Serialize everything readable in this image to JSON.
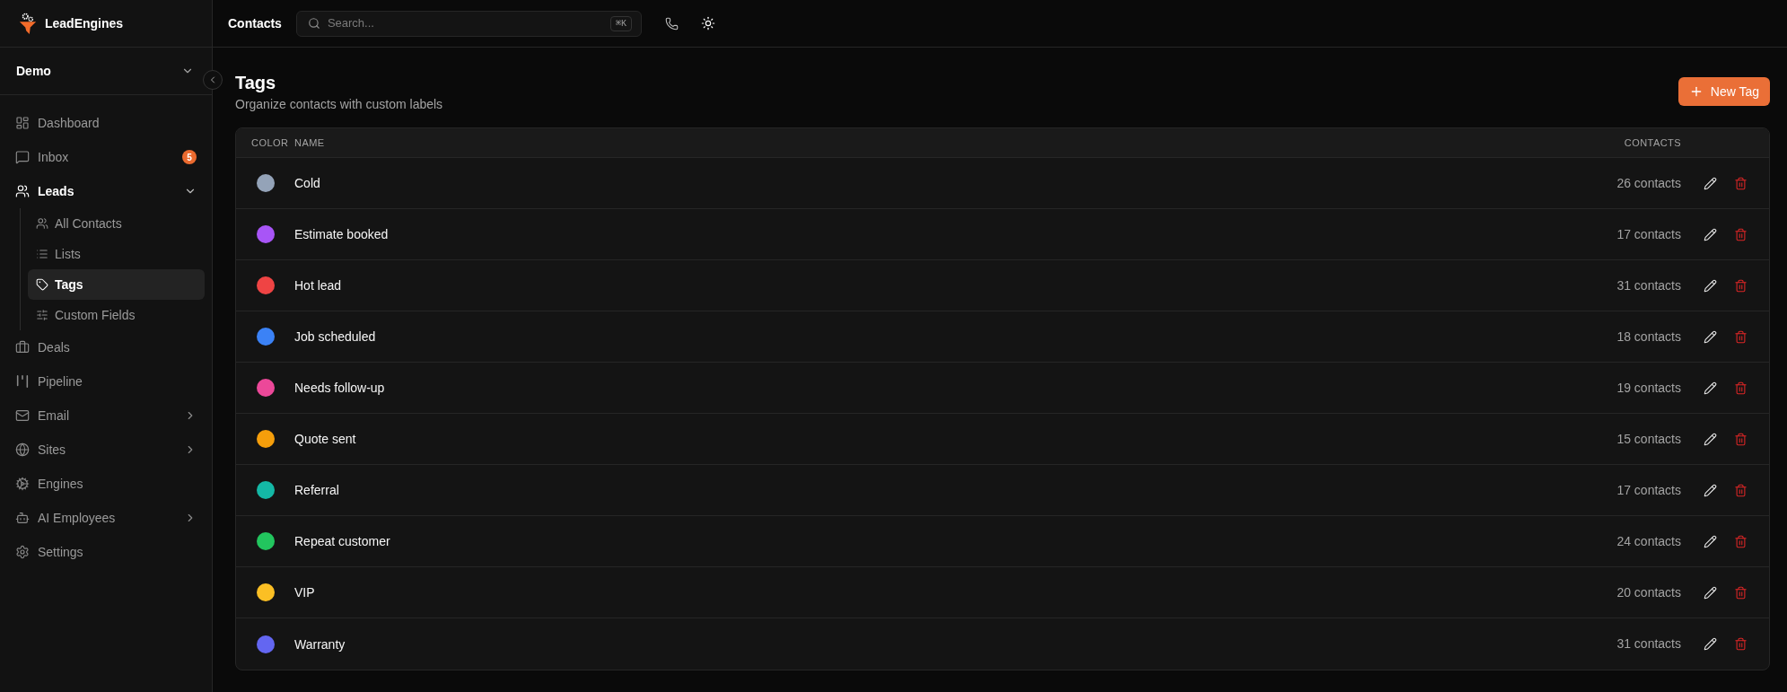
{
  "app": {
    "name": "LeadEngines"
  },
  "workspace": {
    "name": "Demo"
  },
  "sidebar": {
    "items": [
      {
        "label": "Dashboard",
        "selected": false
      },
      {
        "label": "Inbox",
        "selected": false,
        "badge": "5"
      },
      {
        "label": "Leads",
        "selected": false,
        "expanded": true,
        "children": [
          {
            "label": "All Contacts",
            "selected": false
          },
          {
            "label": "Lists",
            "selected": false
          },
          {
            "label": "Tags",
            "selected": true
          },
          {
            "label": "Custom Fields",
            "selected": false
          }
        ]
      },
      {
        "label": "Deals",
        "selected": false
      },
      {
        "label": "Pipeline",
        "selected": false
      },
      {
        "label": "Email",
        "selected": false,
        "expanded": false
      },
      {
        "label": "Sites",
        "selected": false,
        "expanded": false
      },
      {
        "label": "Engines",
        "selected": false
      },
      {
        "label": "AI Employees",
        "selected": false,
        "expanded": false
      },
      {
        "label": "Settings",
        "selected": false
      }
    ]
  },
  "topbar": {
    "title": "Contacts",
    "search": {
      "placeholder": "Search...",
      "shortcut": "⌘K"
    }
  },
  "page": {
    "title": "Tags",
    "subtitle": "Organize contacts with custom labels",
    "primary_button": "New Tag"
  },
  "table": {
    "columns": [
      "COLOR",
      "NAME",
      "CONTACTS"
    ],
    "rows": [
      {
        "name": "Cold",
        "color": "#94a3b8",
        "contacts": "26 contacts"
      },
      {
        "name": "Estimate booked",
        "color": "#a855f7",
        "contacts": "17 contacts"
      },
      {
        "name": "Hot lead",
        "color": "#ef4444",
        "contacts": "31 contacts"
      },
      {
        "name": "Job scheduled",
        "color": "#3b82f6",
        "contacts": "18 contacts"
      },
      {
        "name": "Needs follow-up",
        "color": "#ec4899",
        "contacts": "19 contacts"
      },
      {
        "name": "Quote sent",
        "color": "#f59e0b",
        "contacts": "15 contacts"
      },
      {
        "name": "Referral",
        "color": "#14b8a6",
        "contacts": "17 contacts"
      },
      {
        "name": "Repeat customer",
        "color": "#22c55e",
        "contacts": "24 contacts"
      },
      {
        "name": "VIP",
        "color": "#fbbf24",
        "contacts": "20 contacts"
      },
      {
        "name": "Warranty",
        "color": "#6366f1",
        "contacts": "31 contacts"
      }
    ]
  }
}
